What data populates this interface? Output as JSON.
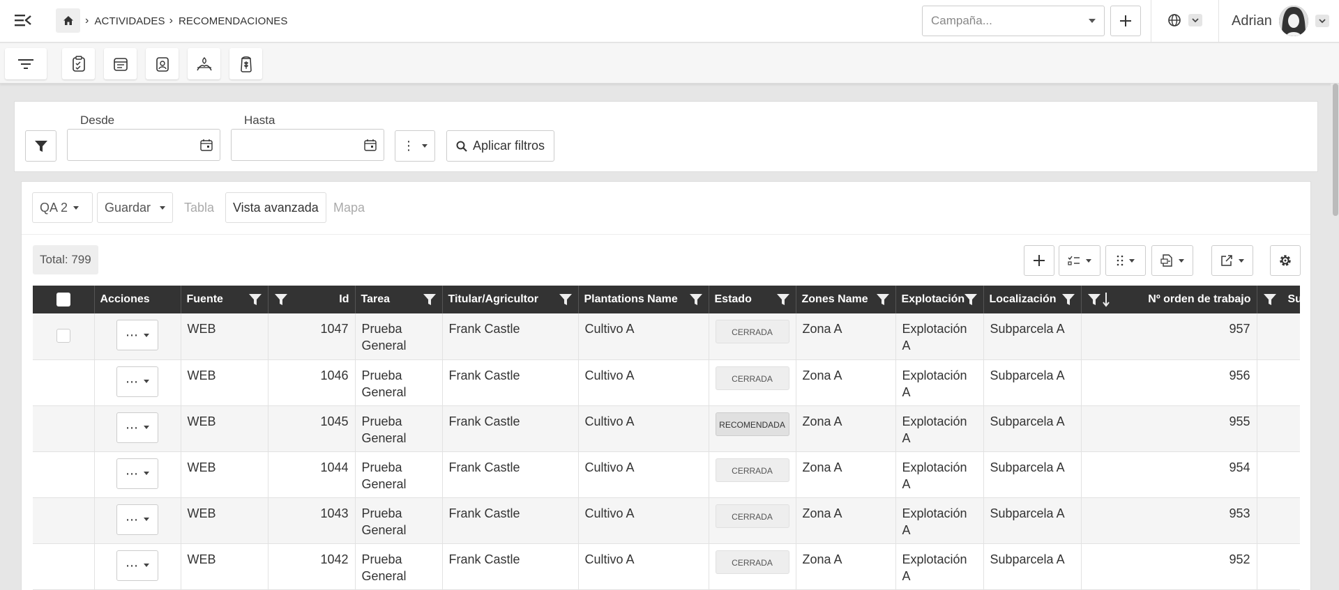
{
  "breadcrumb": {
    "level1": "ACTIVIDADES",
    "level2": "RECOMENDACIONES"
  },
  "campaign": {
    "placeholder": "Campaña..."
  },
  "user": {
    "name": "Adrian"
  },
  "filters": {
    "from_label": "Desde",
    "to_label": "Hasta",
    "from_value": "",
    "to_value": "",
    "apply_label": "Aplicar filtros",
    "more_label": "⋮"
  },
  "view": {
    "layout_select": "QA 2",
    "save_label": "Guardar",
    "tabs": [
      "Tabla",
      "Vista avanzada",
      "Mapa"
    ],
    "active_tab": "Vista avanzada"
  },
  "total": "Total: 799",
  "table": {
    "columns": [
      "Acciones",
      "Fuente",
      "Id",
      "Tarea",
      "Titular/Agricultor",
      "Plantations Name",
      "Estado",
      "Zones Name",
      "Explotación",
      "Localización",
      "Nº orden de trabajo",
      "Su"
    ],
    "rows": [
      {
        "fuente": "WEB",
        "id": "1047",
        "tarea": "Prueba General",
        "titular": "Frank Castle",
        "plantation": "Cultivo A",
        "estado": "CERRADA",
        "zone": "Zona A",
        "explotacion": "Explotación A",
        "localizacion": "Subparcela A",
        "orden": "957"
      },
      {
        "fuente": "WEB",
        "id": "1046",
        "tarea": "Prueba General",
        "titular": "Frank Castle",
        "plantation": "Cultivo A",
        "estado": "CERRADA",
        "zone": "Zona A",
        "explotacion": "Explotación A",
        "localizacion": "Subparcela A",
        "orden": "956"
      },
      {
        "fuente": "WEB",
        "id": "1045",
        "tarea": "Prueba General",
        "titular": "Frank Castle",
        "plantation": "Cultivo A",
        "estado": "RECOMENDADA",
        "zone": "Zona A",
        "explotacion": "Explotación A",
        "localizacion": "Subparcela A",
        "orden": "955"
      },
      {
        "fuente": "WEB",
        "id": "1044",
        "tarea": "Prueba General",
        "titular": "Frank Castle",
        "plantation": "Cultivo A",
        "estado": "CERRADA",
        "zone": "Zona A",
        "explotacion": "Explotación A",
        "localizacion": "Subparcela A",
        "orden": "954"
      },
      {
        "fuente": "WEB",
        "id": "1043",
        "tarea": "Prueba General",
        "titular": "Frank Castle",
        "plantation": "Cultivo A",
        "estado": "CERRADA",
        "zone": "Zona A",
        "explotacion": "Explotación A",
        "localizacion": "Subparcela A",
        "orden": "953"
      },
      {
        "fuente": "WEB",
        "id": "1042",
        "tarea": "Prueba General",
        "titular": "Frank Castle",
        "plantation": "Cultivo A",
        "estado": "CERRADA",
        "zone": "Zona A",
        "explotacion": "Explotación A",
        "localizacion": "Subparcela A",
        "orden": "952"
      }
    ]
  },
  "row_action_label": "⋯",
  "colors": {
    "header_bg": "#333333",
    "row_alt": "#f5f5f5",
    "accent": "#333333"
  },
  "icons": [
    "menu-toggle-icon",
    "home-icon",
    "globe-icon",
    "filter-icon",
    "clipboard-check-icon",
    "calendar-list-icon",
    "badge-user-icon",
    "field-icon",
    "seed-bag-icon",
    "calendar-icon",
    "search-icon",
    "plus-icon",
    "column-select-icon",
    "drag-dots-icon",
    "export-icon",
    "share-icon",
    "gear-icon",
    "funnel-icon",
    "sort-desc-icon"
  ]
}
